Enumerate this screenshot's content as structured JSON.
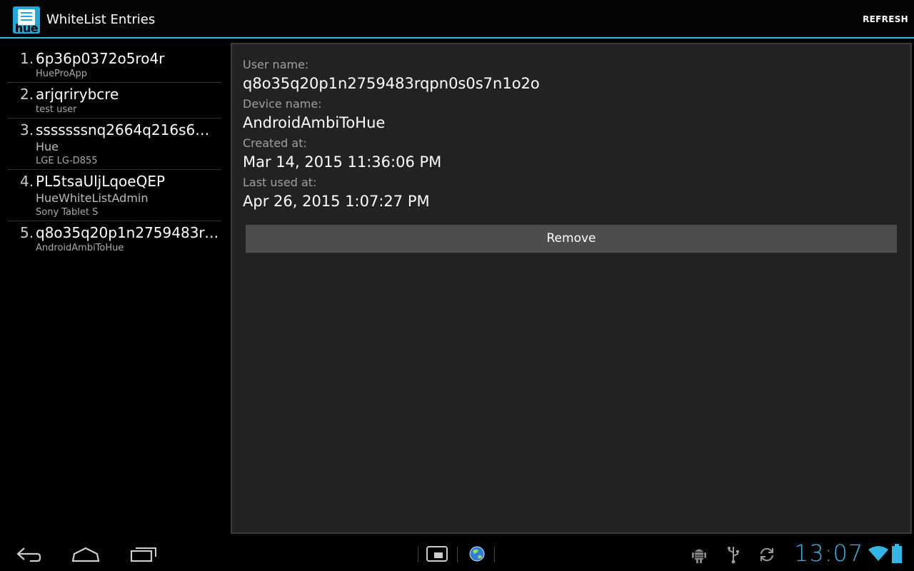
{
  "actionbar": {
    "title": "WhiteList Entries",
    "icon_text": "hue",
    "refresh_label": "REFRESH"
  },
  "entries": [
    {
      "num": "1.",
      "name": "6p36p0372o5ro4r",
      "sub1": "",
      "sub2": "HueProApp"
    },
    {
      "num": "2.",
      "name": "arjqrirybcre",
      "sub1": "",
      "sub2": "test user"
    },
    {
      "num": "3.",
      "name": "sssssssnq2664q216s6…",
      "sub1": "Hue",
      "sub2": "LGE LG-D855"
    },
    {
      "num": "4.",
      "name": "PL5tsaUljLqoeQEP",
      "sub1": "HueWhiteListAdmin",
      "sub2": "Sony Tablet S"
    },
    {
      "num": "5.",
      "name": "q8o35q20p1n2759483rq…",
      "sub1": "",
      "sub2": "AndroidAmbiToHue"
    }
  ],
  "detail": {
    "user_name_label": "User name:",
    "user_name_value": "q8o35q20p1n2759483rqpn0s0s7n1o2o",
    "device_name_label": "Device name:",
    "device_name_value": "AndroidAmbiToHue",
    "created_label": "Created at:",
    "created_value": "Mar 14, 2015 11:36:06 PM",
    "last_used_label": "Last used at:",
    "last_used_value": "Apr 26, 2015 1:07:27 PM",
    "remove_label": "Remove"
  },
  "system_bar": {
    "clock": "13:07",
    "icons": [
      "back-icon",
      "home-icon",
      "recents-icon",
      "screen-compat-icon",
      "browser-globe-icon",
      "android-debug-icon",
      "usb-icon",
      "sync-icon",
      "wifi-icon",
      "battery-icon"
    ]
  },
  "colors": {
    "accent": "#33b5e5",
    "panel_bg": "#222224",
    "button_bg": "#4d4d4d"
  }
}
